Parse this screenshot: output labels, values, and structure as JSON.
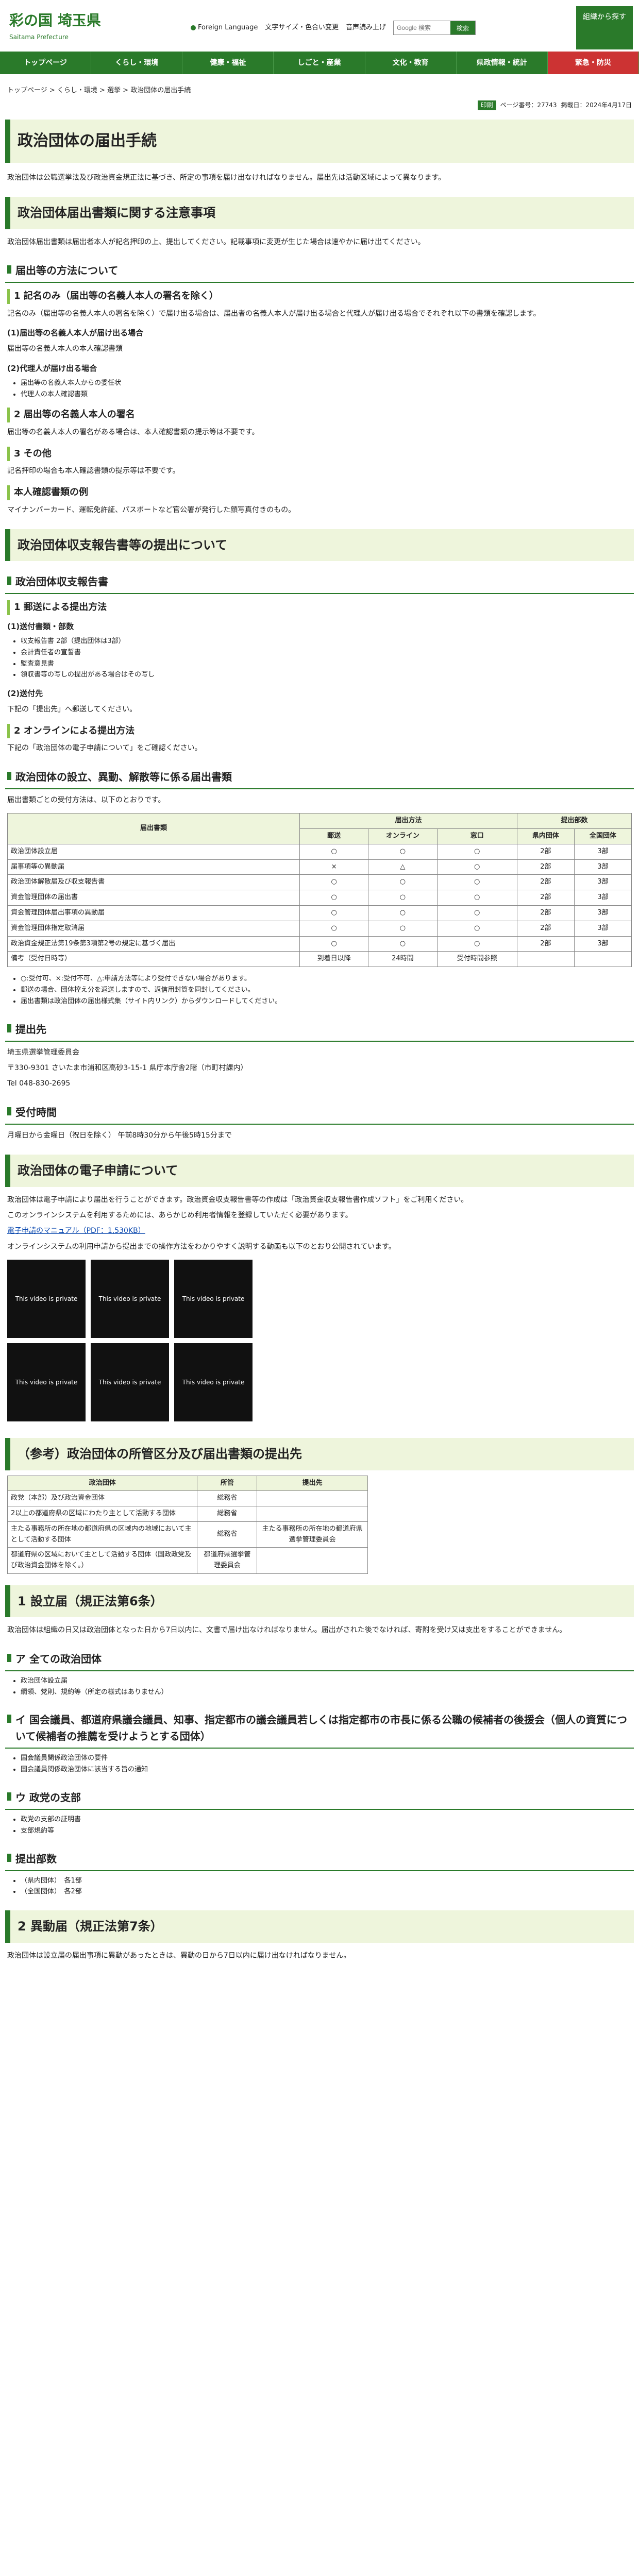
{
  "header": {
    "logo": "彩の国 埼玉県",
    "logo_sub": "Saitama Prefecture",
    "foreign": "Foreign Language",
    "textsize": "文字サイズ・色合い変更",
    "voice": "音声読み上げ",
    "search_placeholder": "Google 検索",
    "search_button": "検索",
    "download": "組織から探す"
  },
  "nav": [
    "トップページ",
    "くらし・環境",
    "健康・福祉",
    "しごと・産業",
    "文化・教育",
    "県政情報・統計",
    "緊急・防災"
  ],
  "breadcrumb": "トップページ > くらし・環境 > 選挙 > 政治団体の届出手続",
  "meta": {
    "print": "印刷",
    "page_no": "ページ番号：27743",
    "updated": "掲載日：2024年4月17日"
  },
  "title": "政治団体の届出手続",
  "intro": "政治団体は公職選挙法及び政治資金規正法に基づき、所定の事項を届け出なければなりません。届出先は活動区域によって異なります。",
  "s1": {
    "h": "政治団体届出書類に関する注意事項",
    "p": "政治団体届出書類は届出者本人が記名押印の上、提出してください。記載事項に変更が生じた場合は速やかに届け出てください。"
  },
  "s1a": {
    "h": "届出等の方法について"
  },
  "s1b": {
    "h": "1 記名のみ（届出等の名義人本人の署名を除く）",
    "p": "記名のみ（届出等の名義人本人の署名を除く）で届け出る場合は、届出者の名義人本人が届け出る場合と代理人が届け出る場合でそれぞれ以下の書類を確認します。"
  },
  "s1c": {
    "h": "(1)届出等の名義人本人が届け出る場合",
    "p": "届出等の名義人本人の本人確認書類"
  },
  "s1d": {
    "h": "(2)代理人が届け出る場合",
    "items": [
      "届出等の名義人本人からの委任状",
      "代理人の本人確認書類"
    ]
  },
  "s1e": {
    "h": "2 届出等の名義人本人の署名",
    "p": "届出等の名義人本人の署名がある場合は、本人確認書類の提示等は不要です。"
  },
  "s1f": {
    "h": "3 その他",
    "p": "記名押印の場合も本人確認書類の提示等は不要です。"
  },
  "s1g": {
    "h": "本人確認書類の例",
    "p": "マイナンバーカード、運転免許証、パスポートなど官公署が発行した顔写真付きのもの。"
  },
  "s2": {
    "h": "政治団体収支報告書等の提出について"
  },
  "s2a": {
    "h": "政治団体収支報告書"
  },
  "s2b": {
    "h": "1 郵送による提出方法"
  },
  "s2c": {
    "h": "(1)送付書類・部数",
    "items": [
      "収支報告書 2部（提出団体は3部）",
      "会計責任者の宣誓書",
      "監査意見書",
      "領収書等の写しの提出がある場合はその写し"
    ]
  },
  "s2d": {
    "h": "(2)送付先",
    "p": "下記の「提出先」へ郵送してください。"
  },
  "s2e": {
    "h": "2 オンラインによる提出方法",
    "p": "下記の「政治団体の電子申請について」をご確認ください。"
  },
  "s3": {
    "h": "政治団体の設立、異動、解散等に係る届出書類",
    "p": "届出書類ごとの受付方法は、以下のとおりです。"
  },
  "tbl": {
    "h_doc": "届出書類",
    "h_method": "届出方法",
    "h_copies": "提出部数",
    "h_sub": [
      "郵送",
      "オンライン",
      "窓口",
      "県内団体",
      "全国団体"
    ],
    "rows": [
      [
        "政治団体設立届",
        "○",
        "○",
        "○",
        "2部",
        "3部"
      ],
      [
        "届事項等の異動届",
        "×",
        "△",
        "○",
        "2部",
        "3部"
      ],
      [
        "政治団体解散届及び収支報告書",
        "○",
        "○",
        "○",
        "2部",
        "3部"
      ],
      [
        "資金管理団体の届出書",
        "○",
        "○",
        "○",
        "2部",
        "3部"
      ],
      [
        "資金管理団体届出事項の異動届",
        "○",
        "○",
        "○",
        "2部",
        "3部"
      ],
      [
        "資金管理団体指定取消届",
        "○",
        "○",
        "○",
        "2部",
        "3部"
      ],
      [
        "政治資金規正法第19条第3項第2号の規定に基づく届出",
        "○",
        "○",
        "○",
        "2部",
        "3部"
      ],
      [
        "備考（受付日時等）",
        "到着日以降",
        "24時間",
        "受付時間参照",
        "",
        ""
      ]
    ]
  },
  "notes": [
    "○:受付可、×:受付不可、△:申請方法等により受付できない場合があります。",
    "郵送の場合、団体控え分を返送しますので、返信用封筒を同封してください。",
    "届出書類は政治団体の届出様式集（サイト内リンク）からダウンロードしてください。"
  ],
  "s4": {
    "h": "提出先",
    "p": "埼玉県選挙管理委員会",
    "addr": "〒330-9301 さいたま市浦和区高砂3-15-1 県庁本庁舎2階（市町村課内）",
    "tel": "Tel 048-830-2695"
  },
  "s5": {
    "h": "受付時間",
    "p": "月曜日から金曜日（祝日を除く） 午前8時30分から午後5時15分まで"
  },
  "s6": {
    "h": "政治団体の電子申請について",
    "p": "政治団体は電子申請により届出を行うことができます。政治資金収支報告書等の作成は「政治資金収支報告書作成ソフト」をご利用ください。",
    "p2": "このオンラインシステムを利用するためには、あらかじめ利用者情報を登録していただく必要があります。",
    "link": "電子申請のマニュアル（PDF：1,530KB）",
    "p3": "オンラインシステムの利用申請から提出までの操作方法をわかりやすく説明する動画も以下のとおり公開されています。",
    "video": "This video is private"
  },
  "s7": {
    "h": "（参考）政治団体の所管区分及び届出書類の提出先",
    "th": [
      "政治団体",
      "所管",
      "提出先"
    ],
    "rows": [
      [
        "政党（本部）及び政治資金団体",
        "総務省",
        ""
      ],
      [
        "2以上の都道府県の区域にわたり主として活動する団体",
        "総務省",
        ""
      ],
      [
        "主たる事務所の所在地の都道府県の区域内の地域において主として活動する団体",
        "総務省",
        "主たる事務所の所在地の都道府県選挙管理委員会"
      ],
      [
        "都道府県の区域において主として活動する団体（国政政党及び政治資金団体を除く。）",
        "都道府県選挙管理委員会",
        ""
      ]
    ]
  },
  "s8": {
    "h": "1 設立届（規正法第6条）",
    "p": "政治団体は組織の日又は政治団体となった日から7日以内に、文書で届け出なければなりません。届出がされた後でなければ、寄附を受け又は支出をすることができません。"
  },
  "s8a": {
    "h": "ア 全ての政治団体",
    "items": [
      "政治団体設立届",
      "綱領、党則、規約等（所定の様式はありません）"
    ]
  },
  "s8b": {
    "h": "イ 国会議員、都道府県議会議員、知事、指定都市の議会議員若しくは指定都市の市長に係る公職の候補者の後援会（個人の資質について候補者の推薦を受けようとする団体）",
    "items": [
      "国会議員関係政治団体の要件",
      "国会議員関係政治団体に該当する旨の通知"
    ]
  },
  "s8c": {
    "h": "ウ 政党の支部",
    "items": [
      "政党の支部の証明書",
      "支部規約等"
    ]
  },
  "s8d": {
    "h": "提出部数",
    "items": [
      "（県内団体）　各1部",
      "（全国団体）　各2部"
    ]
  },
  "s9": {
    "h": "2 異動届（規正法第7条）",
    "p": "政治団体は設立届の届出事項に異動があったときは、異動の日から7日以内に届け出なければなりません。"
  }
}
